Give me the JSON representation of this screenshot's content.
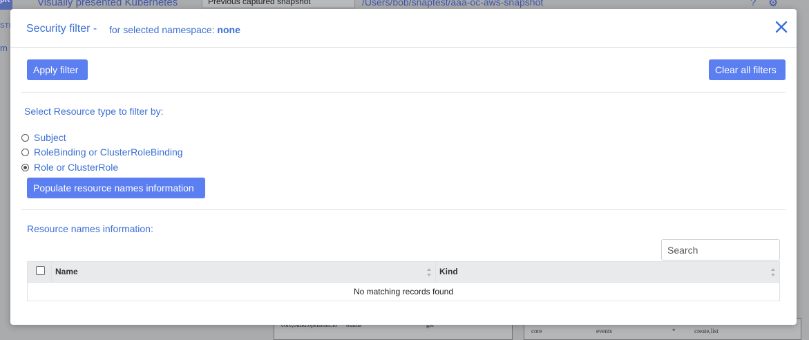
{
  "background": {
    "logo_text": "pK",
    "app_title": "Visually presented Kubernetes",
    "snapshot_select": "Previous captured snapshot",
    "snapshot_path": "/Users/bob/snaptest/aaa-oc-aws-snapshot",
    "help_icon": "question-icon",
    "settings_icon": "gear-icon",
    "left_text_1": "STI",
    "left_text_2": "m",
    "table_fragments": [
      "core,build.openshift.io",
      "builds",
      "get",
      "core",
      "events",
      "*",
      "create,list"
    ]
  },
  "modal": {
    "title": "Security filter -",
    "subtitle_prefix": "for selected namespace:",
    "namespace": "none",
    "close_icon": "close-icon",
    "apply_label": "Apply filter",
    "clear_label": "Clear all filters",
    "resource_type_heading": "Select Resource type to filter by:",
    "resource_types": [
      {
        "label": "Subject",
        "selected": false
      },
      {
        "label": "RoleBinding or ClusterRoleBinding",
        "selected": false
      },
      {
        "label": "Role or ClusterRole",
        "selected": true
      }
    ],
    "populate_label": "Populate resource names information",
    "resource_names_heading": "Resource names information:",
    "search_placeholder": "Search",
    "table": {
      "columns": [
        "Name",
        "Kind"
      ],
      "empty_message": "No matching records found"
    }
  },
  "colors": {
    "accent": "#5b7ef0",
    "link_text": "#3b6fd4",
    "overlay_bg": "#a9abad"
  }
}
